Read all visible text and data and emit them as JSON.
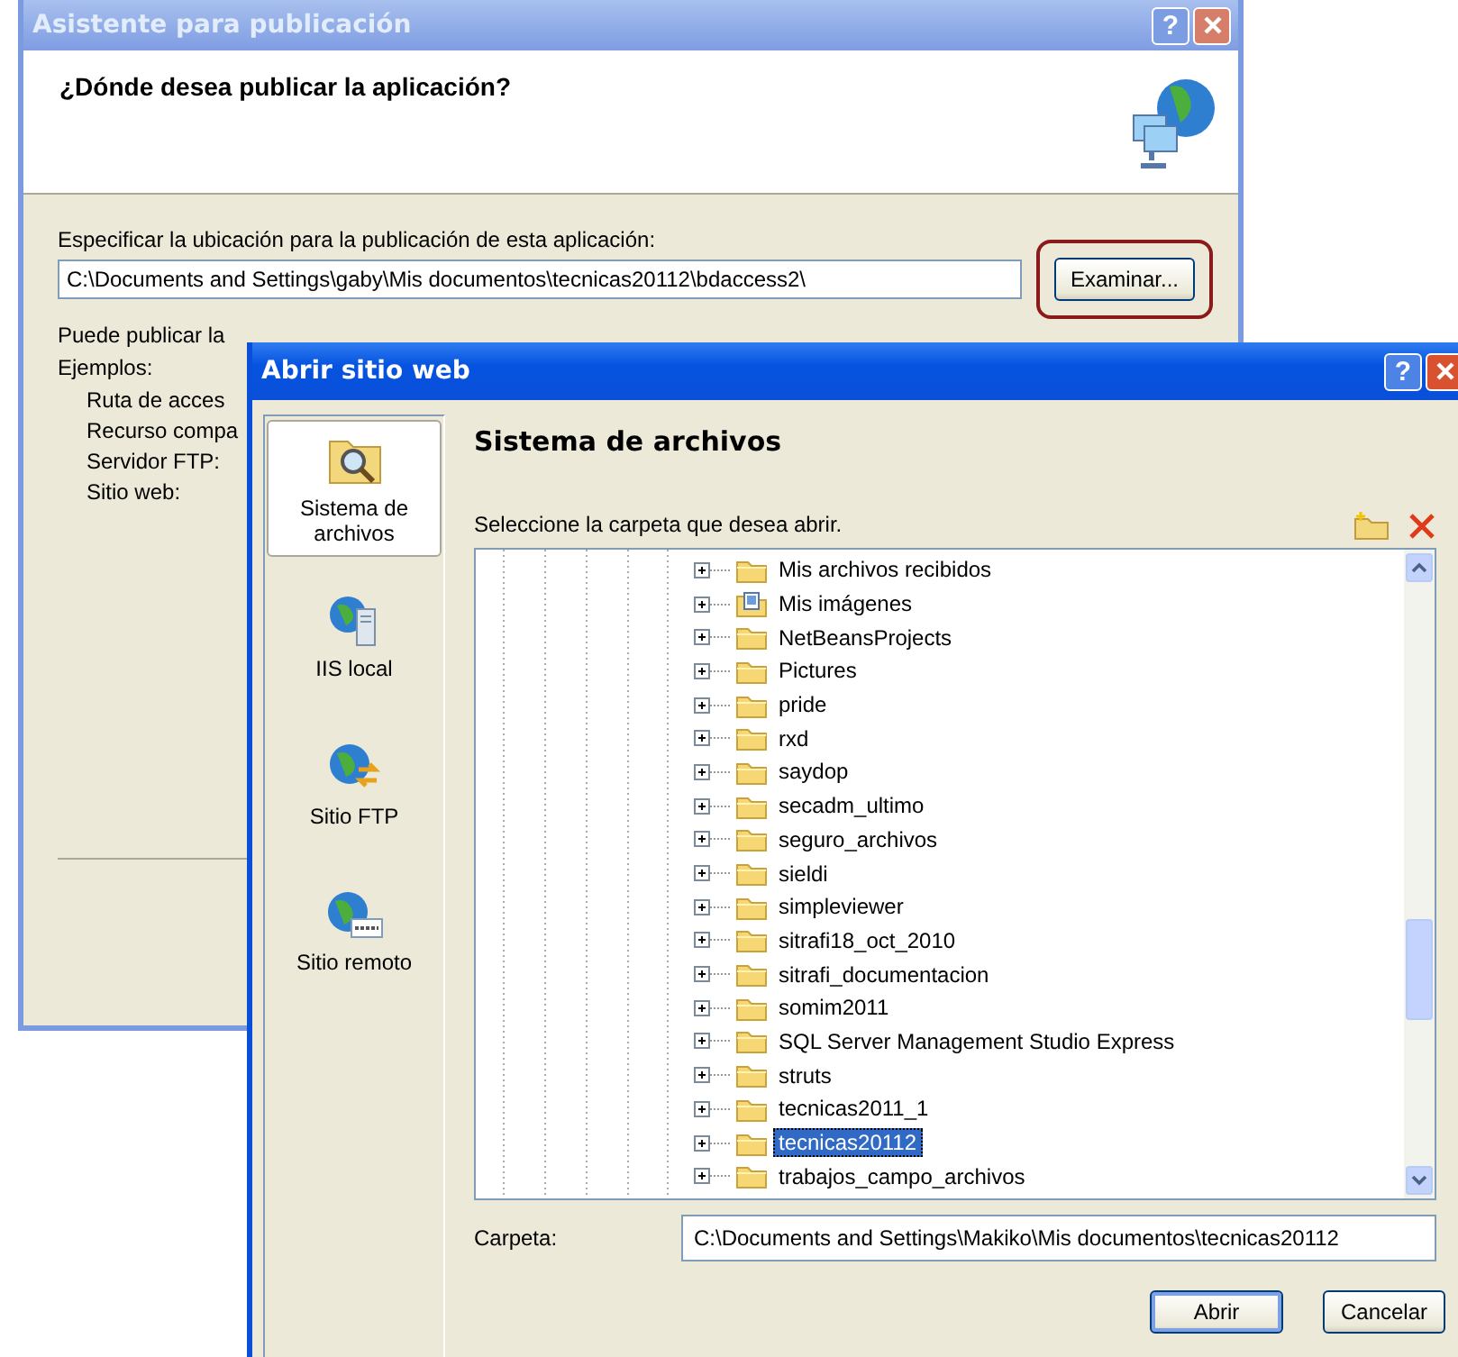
{
  "publish_wizard": {
    "title": "Asistente para publicación",
    "help_button": "?",
    "heading": "¿Dónde desea publicar la aplicación?",
    "location_label": "Especificar la ubicación para la publicación de esta aplicación:",
    "location_value": "C:\\Documents and Settings\\gaby\\Mis documentos\\tecnicas20112\\bdaccess2\\",
    "browse_button": {
      "label": "Examinar...",
      "highlighted": true
    },
    "info_text": "Puede publicar la",
    "examples_label": "Ejemplos:",
    "examples": [
      "Ruta de acces",
      "Recurso compa",
      "Servidor FTP:",
      "Sitio web:"
    ]
  },
  "open_website_dialog": {
    "title": "Abrir sitio web",
    "help_button": "?",
    "locations": [
      {
        "label": "Sistema de archivos",
        "kind": "filesystem",
        "selected": true
      },
      {
        "label": "IIS local",
        "kind": "iis",
        "selected": false
      },
      {
        "label": "Sitio FTP",
        "kind": "ftp",
        "selected": false
      },
      {
        "label": "Sitio remoto",
        "kind": "remote",
        "selected": false
      }
    ],
    "heading": "Sistema de archivos",
    "prompt": "Seleccione la carpeta que desea abrir.",
    "tree_items": [
      {
        "label": "Mis archivos recibidos",
        "kind": "folder",
        "selected": false
      },
      {
        "label": "Mis imágenes",
        "kind": "pictures",
        "selected": false
      },
      {
        "label": "NetBeansProjects",
        "kind": "folder",
        "selected": false
      },
      {
        "label": "Pictures",
        "kind": "folder",
        "selected": false
      },
      {
        "label": "pride",
        "kind": "folder",
        "selected": false
      },
      {
        "label": "rxd",
        "kind": "folder",
        "selected": false
      },
      {
        "label": "saydop",
        "kind": "folder",
        "selected": false
      },
      {
        "label": "secadm_ultimo",
        "kind": "folder",
        "selected": false
      },
      {
        "label": "seguro_archivos",
        "kind": "folder",
        "selected": false
      },
      {
        "label": "sieldi",
        "kind": "folder",
        "selected": false
      },
      {
        "label": "simpleviewer",
        "kind": "folder",
        "selected": false
      },
      {
        "label": "sitrafi18_oct_2010",
        "kind": "folder",
        "selected": false
      },
      {
        "label": "sitrafi_documentacion",
        "kind": "folder",
        "selected": false
      },
      {
        "label": "somim2011",
        "kind": "folder",
        "selected": false
      },
      {
        "label": "SQL Server Management Studio Express",
        "kind": "folder",
        "selected": false
      },
      {
        "label": "struts",
        "kind": "folder",
        "selected": false
      },
      {
        "label": "tecnicas2011_1",
        "kind": "folder",
        "selected": false
      },
      {
        "label": "tecnicas20112",
        "kind": "folder",
        "selected": true
      },
      {
        "label": "trabajos_campo_archivos",
        "kind": "folder",
        "selected": false
      }
    ],
    "folder_label": "Carpeta:",
    "folder_value": "C:\\Documents and Settings\\Makiko\\Mis documentos\\tecnicas20112",
    "buttons": [
      {
        "label": "Abrir",
        "kind": "default"
      },
      {
        "label": "Cancelar",
        "kind": "normal"
      }
    ]
  }
}
